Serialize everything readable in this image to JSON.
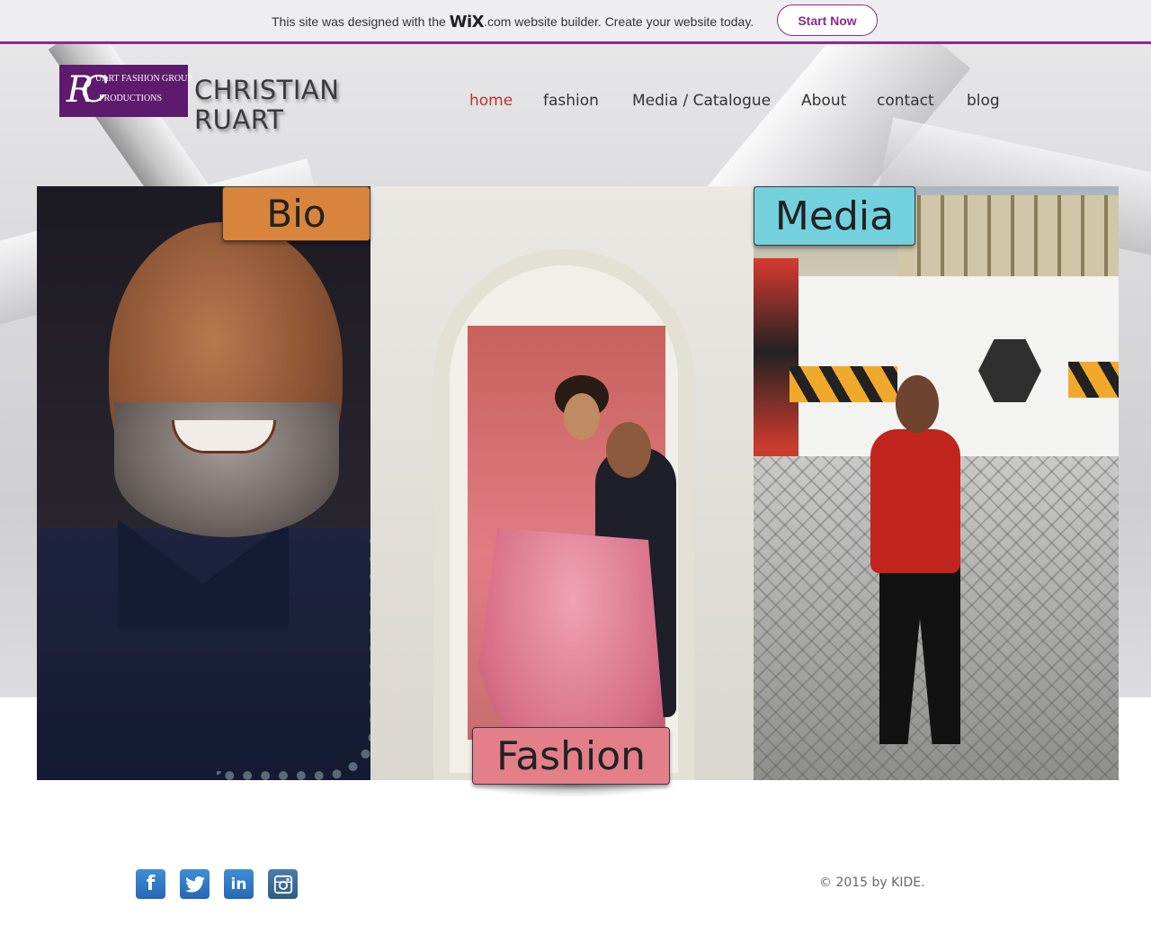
{
  "wix_banner": {
    "text_before": "This site was designed with the",
    "logo": "WiX",
    "logo_suffix": ".com",
    "text_after": "website builder. Create your website today.",
    "cta": "Start Now",
    "accent_color": "#8a2b8e"
  },
  "header": {
    "logo_line1": "UART FASHION GROUP",
    "logo_line2": "PRODUCTIONS",
    "logo_monogram": "RC",
    "site_name_line1": "CHRISTIAN",
    "site_name_line2": "RUART"
  },
  "nav": {
    "items": [
      {
        "label": "home",
        "active": true
      },
      {
        "label": "fashion",
        "active": false
      },
      {
        "label": "Media / Catalogue",
        "active": false
      },
      {
        "label": "About",
        "active": false
      },
      {
        "label": "contact",
        "active": false
      },
      {
        "label": "blog",
        "active": false
      }
    ],
    "active_color": "#b8352c"
  },
  "panels": {
    "bio": {
      "label": "Bio",
      "color": "#d9843c"
    },
    "fashion": {
      "label": "Fashion",
      "color": "#e27f89"
    },
    "media": {
      "label": "Media",
      "color": "#73d1de"
    }
  },
  "footer": {
    "social": [
      {
        "icon": "facebook-icon",
        "glyph": "f"
      },
      {
        "icon": "twitter-icon",
        "glyph": "🐦"
      },
      {
        "icon": "linkedin-icon",
        "glyph": "in"
      },
      {
        "icon": "instagram-icon",
        "glyph": "📷"
      }
    ],
    "copyright": "© 2015 by KIDE."
  }
}
